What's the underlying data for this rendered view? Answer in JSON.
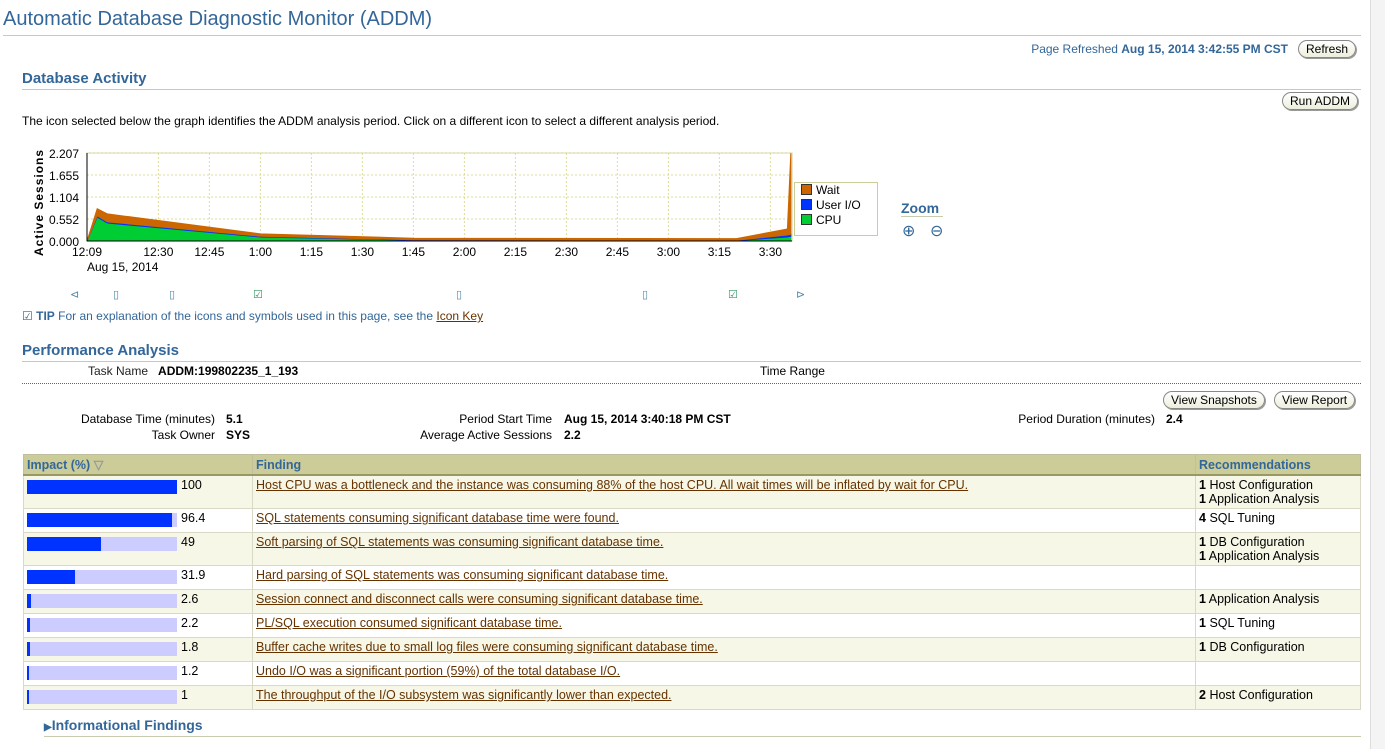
{
  "title": "Automatic Database Diagnostic Monitor (ADDM)",
  "refresh": {
    "label": "Page Refreshed",
    "value": "Aug 15, 2014 3:42:55 PM CST",
    "button": "Refresh"
  },
  "activity": {
    "heading": "Database Activity",
    "run_button": "Run ADDM",
    "intro": "The icon selected below the graph identifies the ADDM analysis period. Click on a different icon to select a different analysis period.",
    "zoom_label": "Zoom",
    "tip_label": "TIP",
    "tip_text": "For an explanation of the icons and symbols used in this page, see the",
    "tip_link": "Icon Key"
  },
  "chart_data": {
    "type": "area",
    "stacked": true,
    "ylabel": "Active Sessions",
    "ylim": [
      0,
      2.207
    ],
    "yticks": [
      "0.000",
      "0.552",
      "1.104",
      "1.655",
      "2.207"
    ],
    "xticks": [
      "12:09",
      "12:30",
      "12:45",
      "1:00",
      "1:15",
      "1:30",
      "1:45",
      "2:00",
      "2:15",
      "2:30",
      "2:45",
      "3:00",
      "3:15",
      "3:30"
    ],
    "xsub": "Aug 15, 2014",
    "grid": true,
    "legend_position": "right",
    "x": [
      "12:09",
      "12:12",
      "12:15",
      "1:00",
      "1:45",
      "3:20",
      "3:35",
      "3:36"
    ],
    "series": [
      {
        "name": "CPU",
        "color": "#00cc33",
        "values": [
          0,
          0.6,
          0.45,
          0.1,
          0.02,
          0.01,
          0.1,
          0.12
        ]
      },
      {
        "name": "User I/O",
        "color": "#0033ff",
        "values": [
          0,
          0.03,
          0.03,
          0.02,
          0.01,
          0.01,
          0.05,
          0.05
        ]
      },
      {
        "name": "Wait",
        "color": "#cc6600",
        "values": [
          0,
          0.18,
          0.2,
          0.06,
          0.04,
          0.04,
          0.15,
          2.03
        ]
      }
    ],
    "legend_order": [
      "Wait",
      "User I/O",
      "CPU"
    ]
  },
  "perf": {
    "heading": "Performance Analysis",
    "task_name_label": "Task Name",
    "task_name": "ADDM:199802235_1_193",
    "time_range_label": "Time Range",
    "view_snapshots": "View Snapshots",
    "view_report": "View Report",
    "db_time_label": "Database Time (minutes)",
    "db_time": "5.1",
    "owner_label": "Task Owner",
    "owner": "SYS",
    "start_label": "Period Start Time",
    "start": "Aug 15, 2014 3:40:18 PM CST",
    "aas_label": "Average Active Sessions",
    "aas": "2.2",
    "duration_label": "Period Duration (minutes)",
    "duration": "2.4"
  },
  "table": {
    "headers": [
      "Impact (%)",
      "Finding",
      "Recommendations"
    ],
    "rows": [
      {
        "impact": 100,
        "finding": "Host CPU was a bottleneck and the instance was consuming 88% of the host CPU. All wait times will be inflated by wait for CPU.",
        "recs": [
          [
            "1",
            "Host Configuration"
          ],
          [
            "1",
            "Application Analysis"
          ]
        ]
      },
      {
        "impact": 96.4,
        "finding": "SQL statements consuming significant database time were found.",
        "recs": [
          [
            "4",
            "SQL Tuning"
          ]
        ]
      },
      {
        "impact": 49,
        "finding": "Soft parsing of SQL statements was consuming significant database time.",
        "recs": [
          [
            "1",
            "DB Configuration"
          ],
          [
            "1",
            "Application Analysis"
          ]
        ]
      },
      {
        "impact": 31.9,
        "finding": "Hard parsing of SQL statements was consuming significant database time.",
        "recs": []
      },
      {
        "impact": 2.6,
        "finding": "Session connect and disconnect calls were consuming significant database time.",
        "recs": [
          [
            "1",
            "Application Analysis"
          ]
        ]
      },
      {
        "impact": 2.2,
        "finding": "PL/SQL execution consumed significant database time.",
        "recs": [
          [
            "1",
            "SQL Tuning"
          ]
        ]
      },
      {
        "impact": 1.8,
        "finding": "Buffer cache writes due to small log files were consuming significant database time.",
        "recs": [
          [
            "1",
            "DB Configuration"
          ]
        ]
      },
      {
        "impact": 1.2,
        "finding": "Undo I/O was a significant portion (59%) of the total database I/O.",
        "recs": []
      },
      {
        "impact": 1,
        "finding": "The throughput of the I/O subsystem was significantly lower than expected.",
        "recs": [
          [
            "2",
            "Host Configuration"
          ]
        ]
      }
    ]
  },
  "informational": "Informational Findings"
}
